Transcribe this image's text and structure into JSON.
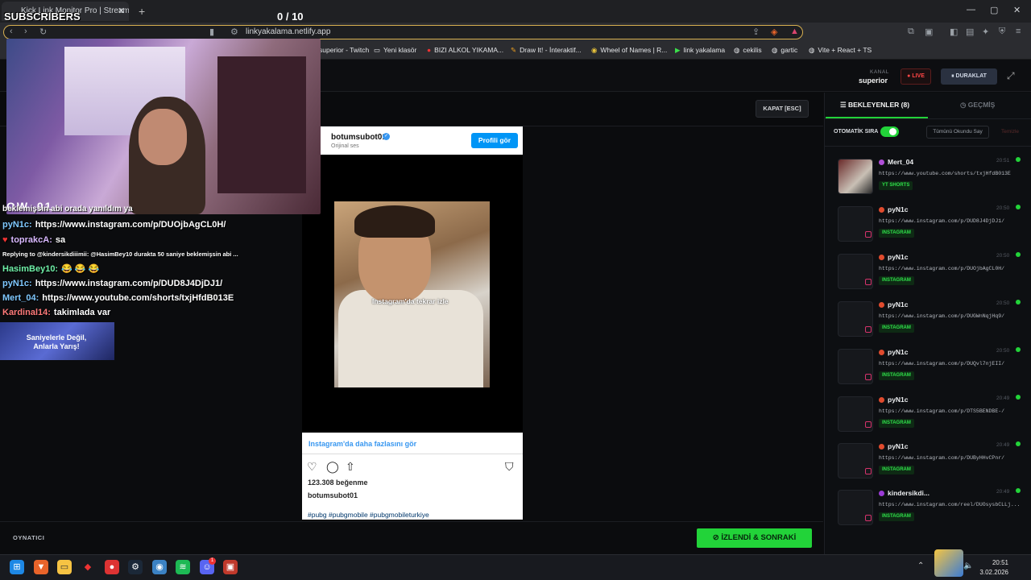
{
  "browser": {
    "tab_title": "Kick Link Monitor Pro | Stream D...",
    "url": "linkyakalama.netlify.app",
    "bookmarks": [
      {
        "label": "superior - Twitch",
        "icon": "twitch-icon"
      },
      {
        "label": "Yeni klasör",
        "icon": "folder-icon"
      },
      {
        "label": "BIZI ALKOL YIKAMA...",
        "icon": "bookmark-icon"
      },
      {
        "label": "Draw It! - İnteraktif...",
        "icon": "pencil-icon"
      },
      {
        "label": "Wheel of Names | R...",
        "icon": "wheel-icon"
      },
      {
        "label": "link yakalama",
        "icon": "kick-icon"
      },
      {
        "label": "cekilis",
        "icon": "globe-icon"
      },
      {
        "label": "gartic",
        "icon": "globe-icon"
      },
      {
        "label": "Vite + React + TS",
        "icon": "globe-icon"
      }
    ]
  },
  "overlay": {
    "subscribers_label": "SUBSCRIBERS",
    "counter": "0  / 10",
    "cam_logo": "OW_01"
  },
  "header": {
    "kanal_label": "KANAL",
    "kanal_name": "superior",
    "live_label": "LIVE",
    "pause_label": "DURAKLAT"
  },
  "content": {
    "close_label": "KAPAT [ESC]",
    "player_label": "OYNATICI",
    "next_label": "İZLENDİ & SONRAKİ"
  },
  "instagram": {
    "username": "botumsubot01",
    "subtitle": "Orijinal ses",
    "profile_button": "Profili gör",
    "replay_text": "Instagram'da tekrar izle",
    "more_link": "Instagram'da daha fazlasını gör",
    "likes": "123.308 beğenme",
    "owner": "botumsubot01",
    "tags": "#pubg #pubgmobile #pubgmobileturkiye"
  },
  "panel": {
    "tab_waiting": "BEKLEYENLER (8)",
    "tab_history": "GEÇMİŞ",
    "auto_label": "OTOMATİK SIRA",
    "mark_read_label": "Tümünü Okundu Say",
    "clear_label": "Temizle",
    "items": [
      {
        "user": "Mert_04",
        "time": "20:51",
        "url": "https://www.youtube.com/shorts/txjHfdB013E",
        "badge": "YT SHORTS",
        "avatar_color": "#b04fd8",
        "thumb": true
      },
      {
        "user": "pyN1c",
        "time": "20:50",
        "url": "https://www.instagram.com/p/DUD8J4DjDJ1/",
        "badge": "INSTAGRAM",
        "avatar_color": "#e04b2e",
        "thumb": false
      },
      {
        "user": "pyN1c",
        "time": "20:50",
        "url": "https://www.instagram.com/p/DUOjbAgCL0H/",
        "badge": "INSTAGRAM",
        "avatar_color": "#e04b2e",
        "thumb": false
      },
      {
        "user": "pyN1c",
        "time": "20:50",
        "url": "https://www.instagram.com/p/DUGWnNqjHq9/",
        "badge": "INSTAGRAM",
        "avatar_color": "#e04b2e",
        "thumb": false
      },
      {
        "user": "pyN1c",
        "time": "20:50",
        "url": "https://www.instagram.com/p/DUQvl7njEII/",
        "badge": "INSTAGRAM",
        "avatar_color": "#e04b2e",
        "thumb": false
      },
      {
        "user": "pyN1c",
        "time": "20:49",
        "url": "https://www.instagram.com/p/DTS5BENDBE-/",
        "badge": "INSTAGRAM",
        "avatar_color": "#e04b2e",
        "thumb": false
      },
      {
        "user": "pyN1c",
        "time": "20:49",
        "url": "https://www.instagram.com/p/DUByHHvCPnr/",
        "badge": "INSTAGRAM",
        "avatar_color": "#e04b2e",
        "thumb": false
      },
      {
        "user": "kindersikdi...",
        "time": "20:49",
        "url": "https://www.instagram.com/reel/DUOsysbCLLj...",
        "badge": "INSTAGRAM",
        "avatar_color": "#9b3bd6",
        "thumb": false
      }
    ]
  },
  "chat": [
    {
      "user": "",
      "text": "beklemişsin abi orada yanıldım ya",
      "color": "#ffffff"
    },
    {
      "user": "pyN1c:",
      "text": "https://www.instagram.com/p/DUOjbAgCL0H/",
      "color": "#7fc8ff"
    },
    {
      "user": "toprakcA:",
      "text": "sa",
      "color": "#d8b8ff"
    },
    {
      "user": "",
      "text": "Replying to @kindersikdiiimii: @HasimBey10 durakta 50 saniye beklemişsin abi ...",
      "color": "#ffffff"
    },
    {
      "user": "HasimBey10:",
      "text": "😂 😂 😂",
      "color": "#6ff0a8"
    },
    {
      "user": "pyN1c:",
      "text": "https://www.instagram.com/p/DUD8J4DjDJ1/",
      "color": "#7fc8ff"
    },
    {
      "user": "Mert_04:",
      "text": "https://www.youtube.com/shorts/txjHfdB013E",
      "color": "#7fc8ff"
    },
    {
      "user": "Kardinal14:",
      "text": "takimlada var",
      "color": "#ff7a7a"
    }
  ],
  "chat_banner": "Saniyelerle Değil, Anlarla Yarış!",
  "taskbar": {
    "time": "20:51",
    "date": "3.02.2026",
    "discord_badge": "1"
  }
}
